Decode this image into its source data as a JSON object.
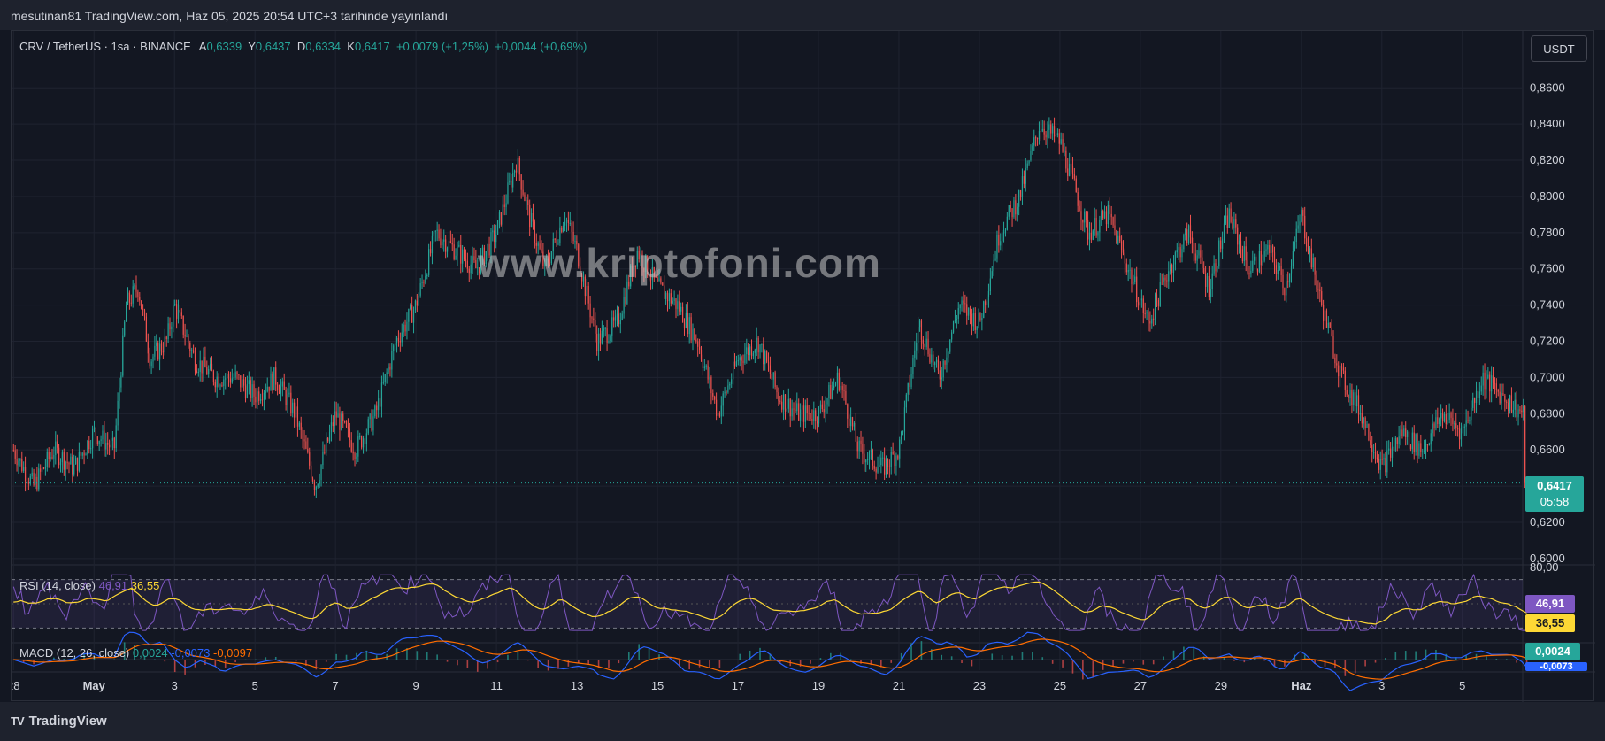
{
  "header": {
    "published": "mesutinan81 TradingView.com, Haz 05, 2025 20:54 UTC+3 tarihinde yayınlandı"
  },
  "legend": {
    "title": "CRV / TetherUS · 1sa · BINANCE",
    "open_label": "A",
    "open": "0,6339",
    "high_label": "Y",
    "high": "0,6437",
    "low_label": "D",
    "low": "0,6334",
    "close_label": "K",
    "close": "0,6417",
    "change": "+0,0079 (+1,25%)",
    "change2": "+0,0044 (+0,69%)"
  },
  "currency": "USDT",
  "watermark": "www.kriptofoni.com",
  "price_label": {
    "value": "0,6417",
    "countdown": "05:58"
  },
  "rsi": {
    "label": "RSI (14, close)",
    "value": "46,91",
    "ma": "36,55",
    "upper": "80,00"
  },
  "macd": {
    "label": "MACD (12, 26, close)",
    "macd": "0,0024",
    "signal": "-0,0073",
    "hist": "-0,0097",
    "pill1": "0,0024",
    "pill2": "-0,0073"
  },
  "footer": {
    "brand": "TradingView",
    "logo_text": "TV"
  },
  "colors": {
    "up": "#26a69a",
    "down": "#ef5350",
    "rsi_line": "#7e57c2",
    "rsi_ma": "#fdd835",
    "macd": "#2962ff",
    "signal": "#ff6d00",
    "price_pill": "#26a69a"
  },
  "chart_data": {
    "type": "candlestick",
    "title": "CRV / TetherUS · 1sa · BINANCE",
    "y_axis": {
      "ticks": [
        "0,8600",
        "0,8400",
        "0,8200",
        "0,8000",
        "0,7800",
        "0,7600",
        "0,7400",
        "0,7200",
        "0,7000",
        "0,6800",
        "0,6600",
        "0,6400",
        "0,6200",
        "0,6000"
      ],
      "range": [
        0.598,
        0.866
      ]
    },
    "x_axis": {
      "labels": [
        "28",
        "May",
        "3",
        "5",
        "7",
        "9",
        "11",
        "13",
        "15",
        "17",
        "19",
        "21",
        "23",
        "25",
        "27",
        "29",
        "Haz",
        "3",
        "5"
      ],
      "positions": [
        0,
        2,
        4,
        6,
        8,
        10,
        12,
        14,
        16,
        18,
        20,
        22,
        24,
        26,
        28,
        30,
        32,
        34,
        36
      ]
    },
    "x_range": [
      -0.05,
      37.5
    ],
    "price_path": [
      [
        0,
        0.66
      ],
      [
        0.5,
        0.64
      ],
      [
        1,
        0.66
      ],
      [
        1.5,
        0.65
      ],
      [
        2,
        0.67
      ],
      [
        2.5,
        0.66
      ],
      [
        2.8,
        0.74
      ],
      [
        3.1,
        0.75
      ],
      [
        3.4,
        0.71
      ],
      [
        3.8,
        0.72
      ],
      [
        4.0,
        0.74
      ],
      [
        4.5,
        0.71
      ],
      [
        5,
        0.7
      ],
      [
        5.5,
        0.7
      ],
      [
        6,
        0.69
      ],
      [
        6.5,
        0.7
      ],
      [
        7.0,
        0.68
      ],
      [
        7.5,
        0.64
      ],
      [
        8.0,
        0.68
      ],
      [
        8.5,
        0.66
      ],
      [
        9,
        0.68
      ],
      [
        9.5,
        0.72
      ],
      [
        10,
        0.74
      ],
      [
        10.5,
        0.78
      ],
      [
        11,
        0.77
      ],
      [
        11.5,
        0.76
      ],
      [
        12,
        0.78
      ],
      [
        12.5,
        0.82
      ],
      [
        12.8,
        0.79
      ],
      [
        13.2,
        0.76
      ],
      [
        13.7,
        0.79
      ],
      [
        14,
        0.77
      ],
      [
        14.5,
        0.72
      ],
      [
        15,
        0.73
      ],
      [
        15.5,
        0.77
      ],
      [
        16,
        0.75
      ],
      [
        16.5,
        0.74
      ],
      [
        17,
        0.72
      ],
      [
        17.5,
        0.68
      ],
      [
        18,
        0.71
      ],
      [
        18.5,
        0.72
      ],
      [
        19,
        0.69
      ],
      [
        19.5,
        0.68
      ],
      [
        20,
        0.68
      ],
      [
        20.5,
        0.7
      ],
      [
        21,
        0.66
      ],
      [
        21.6,
        0.65
      ],
      [
        22,
        0.66
      ],
      [
        22.5,
        0.73
      ],
      [
        23,
        0.7
      ],
      [
        23.5,
        0.74
      ],
      [
        24,
        0.73
      ],
      [
        24.5,
        0.78
      ],
      [
        25,
        0.8
      ],
      [
        25.5,
        0.84
      ],
      [
        26,
        0.83
      ],
      [
        26.3,
        0.81
      ],
      [
        26.7,
        0.78
      ],
      [
        27.2,
        0.79
      ],
      [
        27.7,
        0.76
      ],
      [
        28.2,
        0.73
      ],
      [
        28.7,
        0.76
      ],
      [
        29.2,
        0.78
      ],
      [
        29.7,
        0.75
      ],
      [
        30.2,
        0.79
      ],
      [
        30.7,
        0.76
      ],
      [
        31.2,
        0.77
      ],
      [
        31.6,
        0.75
      ],
      [
        32,
        0.79
      ],
      [
        32.5,
        0.74
      ],
      [
        33,
        0.7
      ],
      [
        33.5,
        0.68
      ],
      [
        34,
        0.65
      ],
      [
        34.5,
        0.67
      ],
      [
        35,
        0.66
      ],
      [
        35.5,
        0.68
      ],
      [
        36,
        0.67
      ],
      [
        36.5,
        0.7
      ],
      [
        37,
        0.69
      ],
      [
        37.5,
        0.68
      ],
      [
        38,
        0.63
      ],
      [
        38.5,
        0.64
      ]
    ],
    "last_price": 0.6417,
    "rsi_range": [
      20,
      80
    ],
    "rsi_bands": [
      70,
      30
    ]
  }
}
